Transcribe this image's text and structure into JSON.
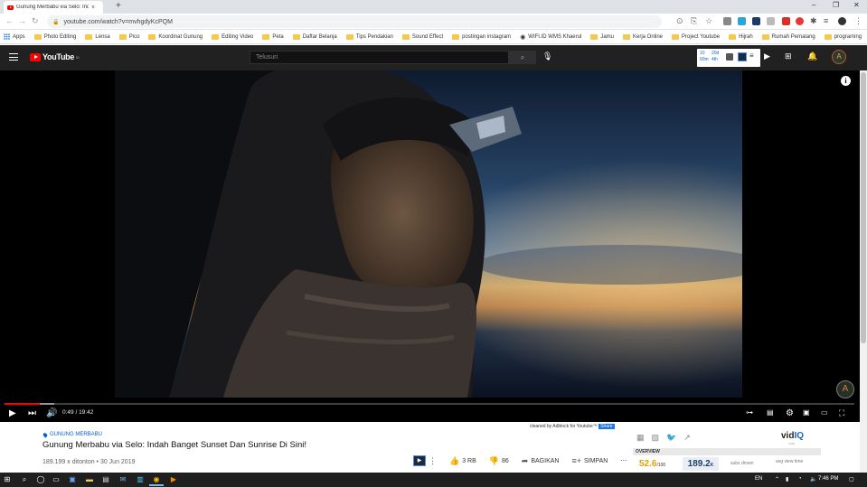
{
  "browser": {
    "tab_title": "Gunung Merbabu via Selo: Indah",
    "url": "youtube.com/watch?v=mvhgdyKcPQM",
    "new_tab": "+",
    "win_min": "–",
    "win_max": "❐",
    "win_close": "✕",
    "tab_close": "×"
  },
  "bookmarks": [
    {
      "label": "Apps",
      "icon": "apps-grid"
    },
    {
      "label": "Photo Editing",
      "icon": "folder"
    },
    {
      "label": "Lensa",
      "icon": "folder"
    },
    {
      "label": "Pico",
      "icon": "folder"
    },
    {
      "label": "Koordinat Gunung",
      "icon": "folder"
    },
    {
      "label": "Editing Video",
      "icon": "folder"
    },
    {
      "label": "Peta",
      "icon": "folder"
    },
    {
      "label": "Daftar Belanja",
      "icon": "folder"
    },
    {
      "label": "Tips Pendakian",
      "icon": "folder"
    },
    {
      "label": "Sound Effect",
      "icon": "folder"
    },
    {
      "label": "postingan instagram",
      "icon": "folder"
    },
    {
      "label": "WIFI.ID WMS Khaerul",
      "icon": "globe"
    },
    {
      "label": "Jamu",
      "icon": "folder"
    },
    {
      "label": "Kerja Online",
      "icon": "folder"
    },
    {
      "label": "Project Youtube",
      "icon": "folder"
    },
    {
      "label": "Hijrah",
      "icon": "folder"
    },
    {
      "label": "Rumah Pemalang",
      "icon": "folder"
    },
    {
      "label": "programing",
      "icon": "folder"
    }
  ],
  "youtube_header": {
    "logo_text": "YouTube",
    "logo_region": "ID",
    "search_placeholder": "Telusuri",
    "vidiq_stats": {
      "a": "10",
      "b": "60m",
      "c": "20d",
      "d": "4th"
    },
    "avatar_letter": "A"
  },
  "player": {
    "current_time": "0:49",
    "duration": "19:42",
    "time_display": "0:49 / 19:42",
    "progress_fraction": 0.0414,
    "watermark_letter": "A"
  },
  "video": {
    "adblock_note": "cleaned by Adblock for Youtube™",
    "adblock_share": "Share",
    "location_tag": "GUNUNG MERBABU",
    "title": "Gunung Merbabu via Selo: Indah Banget Sunset Dan Sunrise Di Sini!",
    "meta": "189.199 x ditonton • 30 Jun 2019",
    "likes": "3 RB",
    "dislikes": "86",
    "share_label": "BAGIKAN",
    "save_label": "SIMPAN",
    "more": "⋯"
  },
  "vidiq": {
    "logo_prefix": "vid",
    "logo_suffix": "IQ",
    "logo_sub": "vidIQ",
    "overview_label": "OVERVIEW",
    "score": "52.6",
    "score_total": "/100",
    "views": "189.2",
    "views_suffix": "K",
    "mini1": "subs driven",
    "mini2": "avg view time"
  },
  "taskbar": {
    "lang": "EN",
    "time": "7:46 PM"
  }
}
